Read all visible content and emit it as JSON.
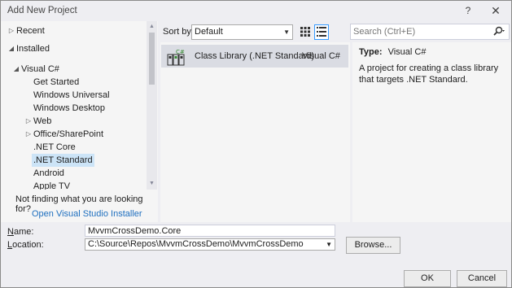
{
  "window": {
    "title": "Add New Project",
    "help_glyph": "?",
    "close_glyph": "✕"
  },
  "sidebar": {
    "items": [
      {
        "label": "Recent",
        "arrow": "▷"
      },
      {
        "label": "Installed",
        "arrow": "◢"
      },
      {
        "label": "Visual C#",
        "arrow": "◢"
      },
      {
        "label": "Get Started"
      },
      {
        "label": "Windows Universal"
      },
      {
        "label": "Windows Desktop"
      },
      {
        "label": "Web",
        "arrow": "▷"
      },
      {
        "label": "Office/SharePoint",
        "arrow": "▷"
      },
      {
        "label": ".NET Core"
      },
      {
        "label": ".NET Standard",
        "selected": true
      },
      {
        "label": "Android"
      },
      {
        "label": "Apple TV"
      }
    ],
    "not_finding": "Not finding what you are looking for?",
    "installer_link": "Open Visual Studio Installer"
  },
  "sortbar": {
    "label": "Sort by:",
    "selected": "Default"
  },
  "templates": [
    {
      "name": "Class Library (.NET Standard)",
      "language": "Visual C#",
      "selected": true
    }
  ],
  "search": {
    "placeholder": "Search (Ctrl+E)"
  },
  "details": {
    "type_label": "Type:",
    "type_value": "Visual C#",
    "description": "A project for creating a class library that targets .NET Standard."
  },
  "form": {
    "name_label_u": "N",
    "name_label_rest": "ame:",
    "name_value": "MvvmCrossDemo.Core",
    "location_label_u": "L",
    "location_label_rest": "ocation:",
    "location_value": "C:\\Source\\Repos\\MvvmCrossDemo\\MvvmCrossDemo",
    "browse_label": "Browse...",
    "ok_label": "OK",
    "cancel_label": "Cancel"
  },
  "colors": {
    "accent": "#3399ff",
    "link": "#1e6fbf",
    "selection": "#cce4f7"
  }
}
